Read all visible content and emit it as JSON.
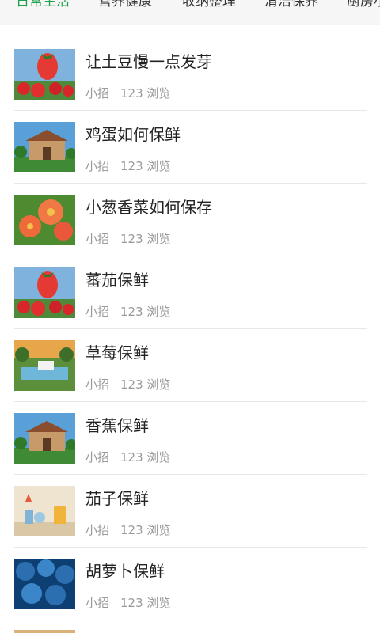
{
  "tabs": [
    {
      "label": "日常生活",
      "active": true
    },
    {
      "label": "营养健康",
      "active": false
    },
    {
      "label": "收纳整理",
      "active": false
    },
    {
      "label": "清洁保养",
      "active": false
    },
    {
      "label": "厨房小",
      "active": false
    }
  ],
  "items": [
    {
      "title": "让土豆慢一点发芽",
      "category": "小招",
      "views": "123 浏览",
      "thumb": "strawberry"
    },
    {
      "title": "鸡蛋如何保鲜",
      "category": "小招",
      "views": "123 浏览",
      "thumb": "house"
    },
    {
      "title": "小葱香菜如何保存",
      "category": "小招",
      "views": "123 浏览",
      "thumb": "flowers"
    },
    {
      "title": "蕃茄保鲜",
      "category": "小招",
      "views": "123 浏览",
      "thumb": "strawberry"
    },
    {
      "title": "草莓保鲜",
      "category": "小招",
      "views": "123 浏览",
      "thumb": "landscape"
    },
    {
      "title": "香蕉保鲜",
      "category": "小招",
      "views": "123 浏览",
      "thumb": "house"
    },
    {
      "title": "茄子保鲜",
      "category": "小招",
      "views": "123 浏览",
      "thumb": "shelf"
    },
    {
      "title": "胡萝卜保鲜",
      "category": "小招",
      "views": "123 浏览",
      "thumb": "blue-berries"
    }
  ],
  "colors": {
    "accent": "#1aa14a",
    "title": "#222222",
    "meta": "#9a9a9a",
    "divider": "#e8e8e8"
  }
}
